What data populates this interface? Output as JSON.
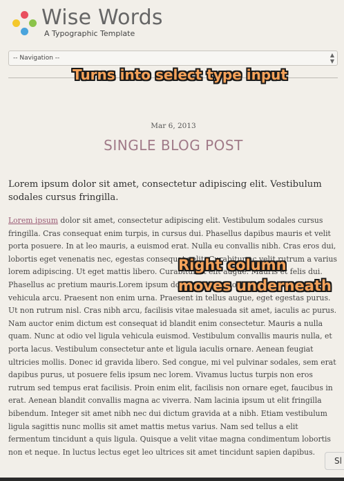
{
  "header": {
    "site_title": "Wise Words",
    "tagline": "A Typographic Template"
  },
  "nav": {
    "select_value": "-- Navigation --"
  },
  "annotations": {
    "select_note": "Turns into select type input",
    "column_note_line1": "Right column",
    "column_note_line2": "moves underneath"
  },
  "post": {
    "date": "Mar 6, 2013",
    "title": "SINGLE BLOG POST",
    "lead": "Lorem ipsum dolor sit amet, consectetur adipiscing elit. Vestibulum sodales cursus fringilla.",
    "link_text": "Lorem ipsum",
    "body": " dolor sit amet, consectetur adipiscing elit. Vestibulum sodales cursus fringilla. Cras consequat enim turpis, in cursus dui. Phasellus dapibus mauris et velit porta posuere. In at leo mauris, a euismod erat. Nulla eu convallis nibh. Cras eros dui, lobortis eget venenatis nec, egestas consequat velit. Curabitur ac velit rutrum a varius lorem adipiscing. Ut eget mattis libero. Curabitur at elit augue. Mauris et felis dui. Phasellus ac pretium mauris.Lorem ipsum dolor sit amet, consectetur. Donec non vehicula arcu. Praesent non enim urna. Praesent in tellus augue, eget egestas purus. Ut non rutrum nisl. Cras nibh arcu, facilisis vitae malesuada sit amet, iaculis ac purus. Nam auctor enim dictum est consequat id blandit enim consectetur. Mauris a nulla quam. Nunc at odio vel ligula vehicula euismod. Vestibulum convallis mauris nulla, et porta lacus. Vestibulum consectetur ante et ligula iaculis ornare. Aenean feugiat ultricies mollis. Donec id gravida libero. Sed congue, mi vel pulvinar sodales, sem erat dapibus purus, ut posuere felis ipsum nec lorem. Vivamus luctus turpis non eros rutrum sed tempus erat facilisis. Proin enim elit, facilisis non ornare eget, faucibus in erat. Aenean blandit convallis magna ac viverra. Nam lacinia ipsum ut elit fringilla bibendum. Integer sit amet nibh nec dui dictum gravida at a nibh. Etiam vestibulum ligula sagittis nunc mollis sit amet mattis metus varius. Nam sed tellus a elit fermentum tincidunt a quis ligula. Quisque a velit vitae magna condimentum lobortis non et neque. In luctus lectus eget leo ultrices sit amet tincidunt sapien dapibus."
  },
  "slide_tab": {
    "label": "Sl"
  },
  "colors": {
    "background": "#f2efe9",
    "title_accent": "#a07a88",
    "link": "#9a5a74",
    "annotation": "#f5a25a"
  }
}
